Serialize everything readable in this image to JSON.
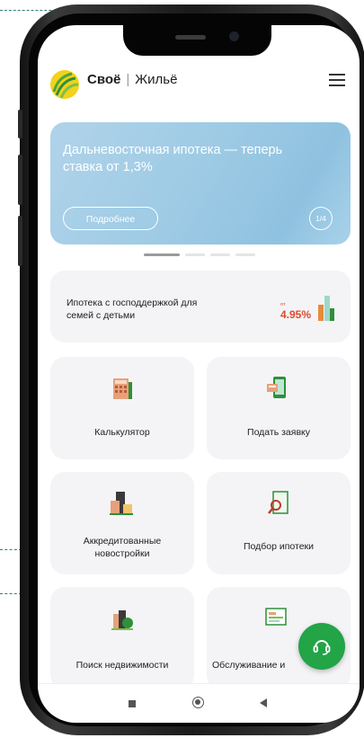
{
  "app": {
    "brand_primary": "Своё",
    "brand_secondary": "Жильё"
  },
  "banner": {
    "text": "Дальневосточная ипотека — теперь ставка от 1,3%",
    "button_label": "Подробнее",
    "counter": "1/4",
    "slides_total": 4,
    "active_slide": 1
  },
  "promo": {
    "title": "Ипотека с господдержкой для семей с детьми",
    "rate_prefix": "от",
    "rate_value": "4.95%"
  },
  "tiles": [
    {
      "label": "Калькулятор",
      "icon": "calculator-icon"
    },
    {
      "label": "Подать заявку",
      "icon": "phone-application-icon"
    },
    {
      "label": "Аккредитованные новостройки",
      "icon": "new-building-icon"
    },
    {
      "label": "Подбор ипотеки",
      "icon": "mortgage-search-icon"
    },
    {
      "label": "Поиск недвижимости",
      "icon": "real-estate-icon"
    },
    {
      "label": "Обслуживание и",
      "icon": "service-icon"
    }
  ],
  "colors": {
    "accent_green": "#22a447",
    "rate_red": "#e0472e",
    "banner_blue": "#9fcbe5",
    "card_bg": "#f4f4f6"
  },
  "fab": {
    "icon": "support-headset-icon"
  },
  "navbar": {
    "icons": [
      "square-nav-icon",
      "circle-nav-icon",
      "back-triangle-icon"
    ]
  }
}
